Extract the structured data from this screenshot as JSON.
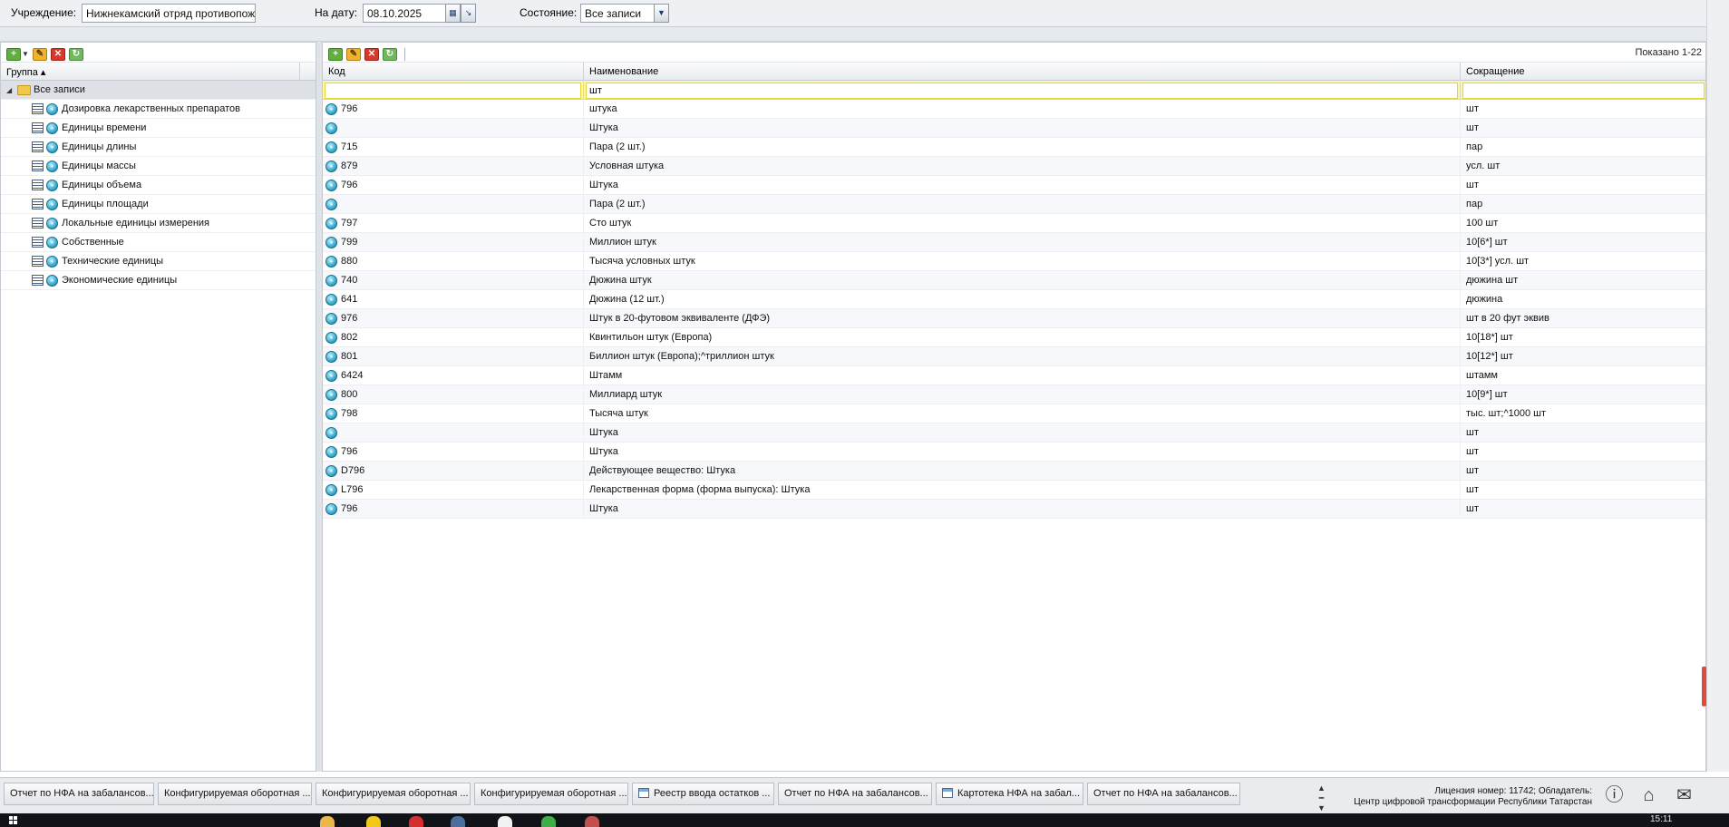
{
  "filters": {
    "institution_label": "Учреждение:",
    "institution_value": "Нижнекамский отряд противопож",
    "date_label": "На дату:",
    "date_value": "08.10.2025",
    "state_label": "Состояние:",
    "state_value": "Все записи"
  },
  "tree": {
    "column": "Группа",
    "root": "Все записи",
    "items": [
      "Дозировка лекарственных препаратов",
      "Единицы времени",
      "Единицы длины",
      "Единицы массы",
      "Единицы объема",
      "Единицы площади",
      "Локальные единицы измерения",
      "Собственные",
      "Технические единицы",
      "Экономические единицы"
    ]
  },
  "grid": {
    "shown_text": "Показано 1-22",
    "columns": {
      "code": "Код",
      "name": "Наименование",
      "abbr": "Сокращение"
    },
    "filter": {
      "code": "",
      "name": "шт",
      "abbr": ""
    },
    "rows": [
      {
        "code": "796",
        "name": "штука",
        "abbr": "шт"
      },
      {
        "code": "",
        "name": "Штука",
        "abbr": "шт"
      },
      {
        "code": "715",
        "name": "Пара (2 шт.)",
        "abbr": "пар"
      },
      {
        "code": "879",
        "name": "Условная штука",
        "abbr": "усл. шт"
      },
      {
        "code": "796",
        "name": "Штука",
        "abbr": "шт"
      },
      {
        "code": "",
        "name": "Пара (2 шт.)",
        "abbr": "пар"
      },
      {
        "code": "797",
        "name": "Сто штук",
        "abbr": "100 шт"
      },
      {
        "code": "799",
        "name": "Миллион штук",
        "abbr": "10[6*] шт"
      },
      {
        "code": "880",
        "name": "Тысяча условных штук",
        "abbr": "10[3*] усл. шт"
      },
      {
        "code": "740",
        "name": "Дюжина штук",
        "abbr": "дюжина шт"
      },
      {
        "code": "641",
        "name": "Дюжина (12 шт.)",
        "abbr": "дюжина"
      },
      {
        "code": "976",
        "name": "Штук в 20-футовом эквиваленте (ДФЭ)",
        "abbr": "шт в 20 фут эквив"
      },
      {
        "code": "802",
        "name": "Квинтильон штук (Европа)",
        "abbr": "10[18*] шт"
      },
      {
        "code": "801",
        "name": "Биллион штук (Европа);^триллион штук",
        "abbr": "10[12*] шт"
      },
      {
        "code": "6424",
        "name": "Штамм",
        "abbr": "штамм"
      },
      {
        "code": "800",
        "name": "Миллиард штук",
        "abbr": "10[9*] шт"
      },
      {
        "code": "798",
        "name": "Тысяча штук",
        "abbr": "тыс. шт;^1000 шт"
      },
      {
        "code": "",
        "name": "Штука",
        "abbr": "шт"
      },
      {
        "code": "796",
        "name": "Штука",
        "abbr": "шт"
      },
      {
        "code": "D796",
        "name": "Действующее вещество: Штука",
        "abbr": "шт"
      },
      {
        "code": "L796",
        "name": "Лекарственная форма (форма выпуска): Штука",
        "abbr": "шт"
      },
      {
        "code": "796",
        "name": "Штука",
        "abbr": "шт"
      }
    ]
  },
  "taskbar": {
    "tasks": [
      "Отчет по НФА на забалансов...",
      "Конфигурируемая оборотная ...",
      "Конфигурируемая оборотная ...",
      "Конфигурируемая оборотная ...",
      "Реестр ввода остатков ...",
      "Отчет по НФА на забалансов...",
      "Картотека НФА на забал...",
      "Отчет по НФА на забалансов..."
    ],
    "license_line1": "Лицензия номер: 11742; Обладатель:",
    "license_line2": "Центр цифровой трансформации Республики Татарстан"
  },
  "os": {
    "clock": "15:11"
  },
  "colors": {
    "filter_row": "#fff7a6",
    "selection": "#dde1e6",
    "accent_red": "#e14b3b"
  }
}
